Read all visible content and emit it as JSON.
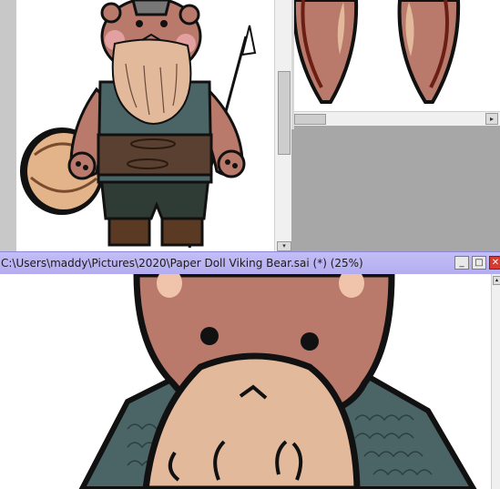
{
  "document_window": {
    "title": "C:\\Users\\maddy\\Pictures\\2020\\Paper Doll Viking Bear.sai (*) (25%)",
    "minimize_glyph": "_",
    "maximize_glyph": "□",
    "close_glyph": "✕"
  },
  "scrollbars": {
    "down_arrow": "▾",
    "right_arrow": "▸",
    "up_arrow": "▴"
  },
  "icons": {
    "minimize": "minimize-icon",
    "maximize": "maximize-icon",
    "close": "close-icon"
  },
  "colors": {
    "title_bar": "#b9b4f3",
    "fur": "#b97a6c",
    "muzzle": "#e3b99c",
    "chainmail": "#4b6567",
    "belt": "#5a4030",
    "outline": "#111111"
  }
}
